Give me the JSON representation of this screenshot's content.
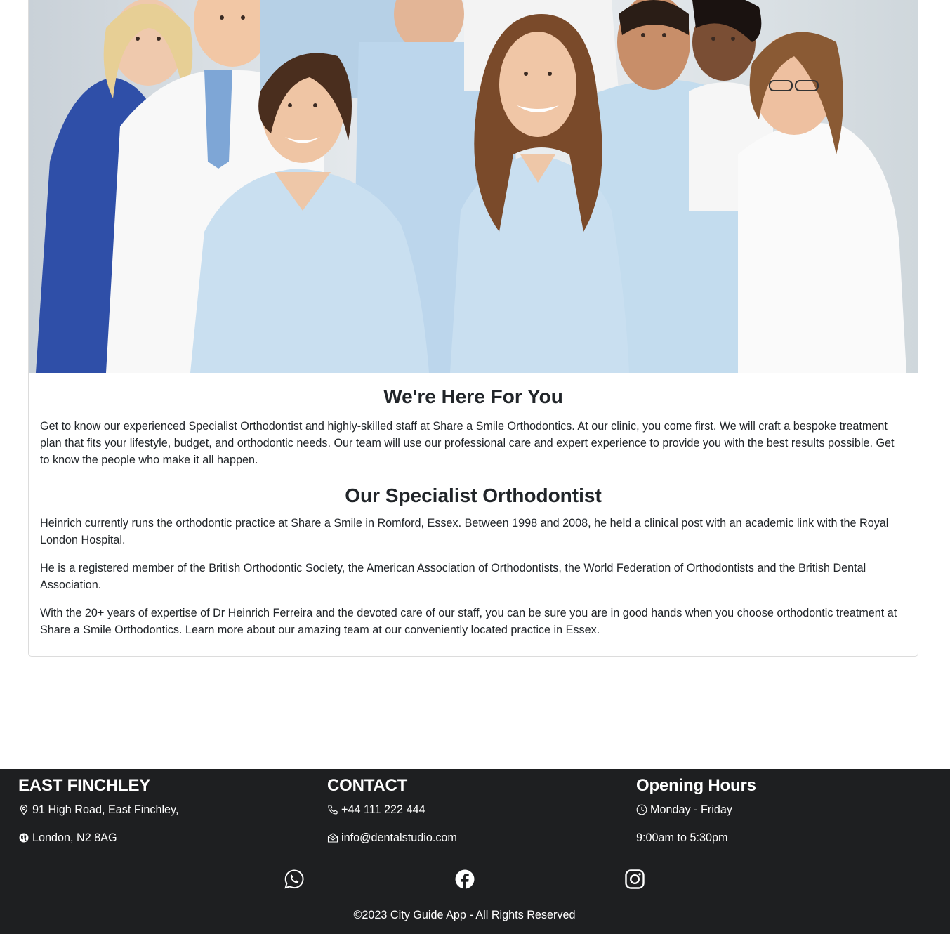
{
  "hero": {
    "image_alt": "Smiling dental team in scrubs and white coats"
  },
  "about": {
    "title": "We're Here For You",
    "intro": "Get to know our experienced Specialist Orthodontist and highly-skilled staff at Share a Smile Orthodontics. At our clinic, you come first. We will craft a bespoke treatment plan that fits your lifestyle, budget, and orthodontic needs. Our team will use our professional care and expert experience to provide you with the best results possible. Get to know the people who make it all happen.",
    "specialist_title": "Our Specialist Orthodontist",
    "paragraphs": [
      "Heinrich currently runs the orthodontic practice at Share a Smile in Romford, Essex. Between 1998 and 2008, he held a clinical post with an academic link with the Royal London Hospital.",
      "He is a registered member of the British Orthodontic Society, the American Association of Orthodontists, the World Federation of Orthodontists and the British Dental Association.",
      "With the 20+ years of expertise of Dr Heinrich Ferreira and the devoted care of our staff, you can be sure you are in good hands when you choose orthodontic treatment at Share a Smile Orthodontics. Learn more about our amazing team at our conveniently located practice in Essex."
    ]
  },
  "footer": {
    "location": {
      "heading": "EAST FINCHLEY",
      "address_line1": "91 High Road, East Finchley,",
      "address_line2": "London, N2 8AG",
      "icons": [
        "map-pin-icon",
        "globe-icon"
      ]
    },
    "contact": {
      "heading": "CONTACT",
      "phone": "+44 111 222 444",
      "email": "info@dentalstudio.com",
      "icons": [
        "phone-icon",
        "envelope-icon"
      ]
    },
    "hours": {
      "heading": "Opening Hours",
      "days": "Monday - Friday",
      "time": "9:00am to 5:30pm",
      "icons": [
        "clock-icon"
      ]
    },
    "social": [
      "whatsapp-icon",
      "facebook-icon",
      "instagram-icon"
    ],
    "copyright": "©2023 City Guide App - All Rights Reserved"
  },
  "colors": {
    "footer_bg": "#1e1f21",
    "text": "#212529",
    "scrubs": "#c9dff0",
    "coat": "#f7f7f7"
  }
}
